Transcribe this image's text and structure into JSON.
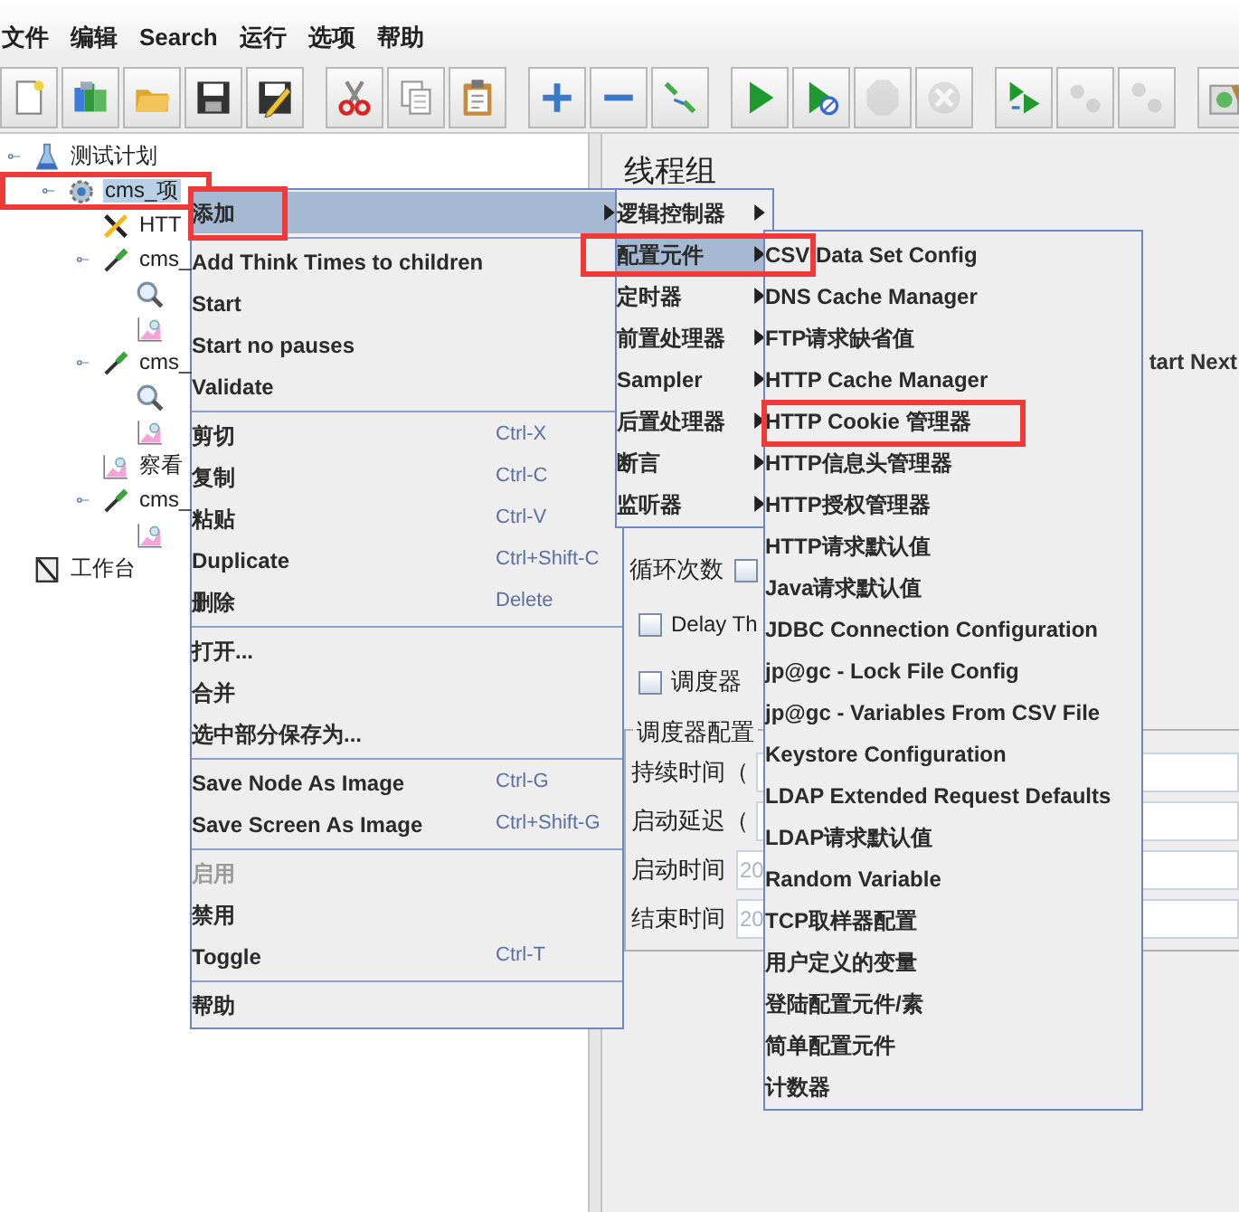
{
  "menu_bar": [
    "文件",
    "编辑",
    "Search",
    "运行",
    "选项",
    "帮助"
  ],
  "toolbar": [
    [
      {
        "disabled": false
      },
      {
        "disabled": false
      },
      {
        "disabled": false
      },
      {
        "disabled": false
      },
      {
        "disabled": false
      }
    ],
    [
      {
        "disabled": false
      },
      {
        "disabled": false
      },
      {
        "disabled": false
      }
    ],
    [
      {
        "disabled": false
      },
      {
        "disabled": false
      },
      {
        "disabled": false
      }
    ],
    [
      {
        "disabled": false
      },
      {
        "disabled": false
      },
      {
        "disabled": true
      },
      {
        "disabled": true
      }
    ],
    [
      {
        "disabled": false
      },
      {
        "disabled": true
      },
      {
        "disabled": true
      }
    ],
    [
      {
        "disabled": false
      }
    ]
  ],
  "tree": [
    {
      "label": "测试计划",
      "kind": "test-plan",
      "selected": false,
      "children": [
        {
          "label": "cms_项",
          "kind": "thread-group",
          "selected": true,
          "marked": true,
          "children": [
            {
              "label": "HTT",
              "kind": "config",
              "selected": false
            },
            {
              "label": "cms_",
              "kind": "sampler",
              "selected": false,
              "children": [
                {
                  "kind": "view"
                },
                {
                  "kind": "graph"
                }
              ]
            },
            {
              "label": "cms_",
              "kind": "sampler",
              "selected": false,
              "children": [
                {
                  "kind": "view"
                },
                {
                  "kind": "graph"
                }
              ]
            },
            {
              "label": "察看",
              "kind": "graph",
              "selected": false
            },
            {
              "label": "cms_",
              "kind": "sampler",
              "selected": false,
              "children": [
                {
                  "kind": "graph"
                }
              ]
            }
          ]
        }
      ]
    },
    {
      "label": "工作台",
      "kind": "workbench",
      "selected": false
    }
  ],
  "panel": {
    "title": "线程组",
    "next_action_option": "tart Next",
    "loop": {
      "label": "循环次数",
      "checked": false
    },
    "delay": {
      "label": "Delay Th",
      "checked": false
    },
    "scheduler": {
      "label": "调度器",
      "checked": false
    },
    "scheduler_config": {
      "title": "调度器配置",
      "fields": [
        {
          "label": "持续时间（"
        },
        {
          "label": "启动延迟（"
        },
        {
          "label": "启动时间",
          "value": "20"
        },
        {
          "label": "结束时间",
          "value": "20"
        }
      ]
    }
  },
  "context_menu": [
    {
      "kind": "item",
      "label": "添加",
      "has_submenu": true,
      "selected": true,
      "marked": true
    },
    {
      "kind": "separator"
    },
    {
      "kind": "item",
      "label": "Add Think Times to children",
      "selected": false
    },
    {
      "kind": "item",
      "label": "Start",
      "selected": false
    },
    {
      "kind": "item",
      "label": "Start no pauses",
      "selected": false
    },
    {
      "kind": "item",
      "label": "Validate",
      "selected": false
    },
    {
      "kind": "separator"
    },
    {
      "kind": "item",
      "label": "剪切",
      "shortcut": "Ctrl-X",
      "selected": false
    },
    {
      "kind": "item",
      "label": "复制",
      "shortcut": "Ctrl-C",
      "selected": false
    },
    {
      "kind": "item",
      "label": "粘贴",
      "shortcut": "Ctrl-V",
      "selected": false
    },
    {
      "kind": "item",
      "label": "Duplicate",
      "shortcut": "Ctrl+Shift-C",
      "selected": false
    },
    {
      "kind": "item",
      "label": "删除",
      "shortcut": "Delete",
      "selected": false
    },
    {
      "kind": "separator"
    },
    {
      "kind": "item",
      "label": "打开...",
      "selected": false
    },
    {
      "kind": "item",
      "label": "合并",
      "selected": false
    },
    {
      "kind": "item",
      "label": "选中部分保存为...",
      "selected": false
    },
    {
      "kind": "separator"
    },
    {
      "kind": "item",
      "label": "Save Node As Image",
      "shortcut": "Ctrl-G",
      "selected": false
    },
    {
      "kind": "item",
      "label": "Save Screen As Image",
      "shortcut": "Ctrl+Shift-G",
      "selected": false
    },
    {
      "kind": "separator"
    },
    {
      "kind": "item",
      "label": "启用",
      "disabled": true,
      "selected": false
    },
    {
      "kind": "item",
      "label": "禁用",
      "selected": false
    },
    {
      "kind": "item",
      "label": "Toggle",
      "shortcut": "Ctrl-T",
      "selected": false
    },
    {
      "kind": "separator"
    },
    {
      "kind": "item",
      "label": "帮助",
      "selected": false
    }
  ],
  "add_submenu": [
    {
      "kind": "item",
      "label": "逻辑控制器",
      "has_submenu": true,
      "selected": false
    },
    {
      "kind": "item",
      "label": "配置元件",
      "has_submenu": true,
      "selected": true,
      "marked": true
    },
    {
      "kind": "item",
      "label": "定时器",
      "has_submenu": true,
      "selected": false
    },
    {
      "kind": "item",
      "label": "前置处理器",
      "has_submenu": true,
      "selected": false
    },
    {
      "kind": "item",
      "label": "Sampler",
      "has_submenu": true,
      "selected": false
    },
    {
      "kind": "item",
      "label": "后置处理器",
      "has_submenu": true,
      "selected": false
    },
    {
      "kind": "item",
      "label": "断言",
      "has_submenu": true,
      "selected": false
    },
    {
      "kind": "item",
      "label": "监听器",
      "has_submenu": true,
      "selected": false
    }
  ],
  "config_submenu": [
    {
      "kind": "item",
      "label": "CSV Data Set Config",
      "selected": false
    },
    {
      "kind": "item",
      "label": "DNS Cache Manager",
      "selected": false
    },
    {
      "kind": "item",
      "label": "FTP请求缺省值",
      "selected": false
    },
    {
      "kind": "item",
      "label": "HTTP Cache Manager",
      "selected": false
    },
    {
      "kind": "item",
      "label": "HTTP Cookie 管理器",
      "selected": false,
      "marked": true
    },
    {
      "kind": "item",
      "label": "HTTP信息头管理器",
      "selected": false
    },
    {
      "kind": "item",
      "label": "HTTP授权管理器",
      "selected": false
    },
    {
      "kind": "item",
      "label": "HTTP请求默认值",
      "selected": false
    },
    {
      "kind": "item",
      "label": "Java请求默认值",
      "selected": false
    },
    {
      "kind": "item",
      "label": "JDBC Connection Configuration",
      "selected": false
    },
    {
      "kind": "item",
      "label": "jp@gc - Lock File Config",
      "selected": false
    },
    {
      "kind": "item",
      "label": "jp@gc - Variables From CSV File",
      "selected": false
    },
    {
      "kind": "item",
      "label": "Keystore Configuration",
      "selected": false
    },
    {
      "kind": "item",
      "label": "LDAP Extended Request Defaults",
      "selected": false
    },
    {
      "kind": "item",
      "label": "LDAP请求默认值",
      "selected": false
    },
    {
      "kind": "item",
      "label": "Random Variable",
      "selected": false
    },
    {
      "kind": "item",
      "label": "TCP取样器配置",
      "selected": false
    },
    {
      "kind": "item",
      "label": "用户定义的变量",
      "selected": false
    },
    {
      "kind": "item",
      "label": "登陆配置元件/素",
      "selected": false
    },
    {
      "kind": "item",
      "label": "简单配置元件",
      "selected": false
    },
    {
      "kind": "item",
      "label": "计数器",
      "selected": false
    }
  ]
}
